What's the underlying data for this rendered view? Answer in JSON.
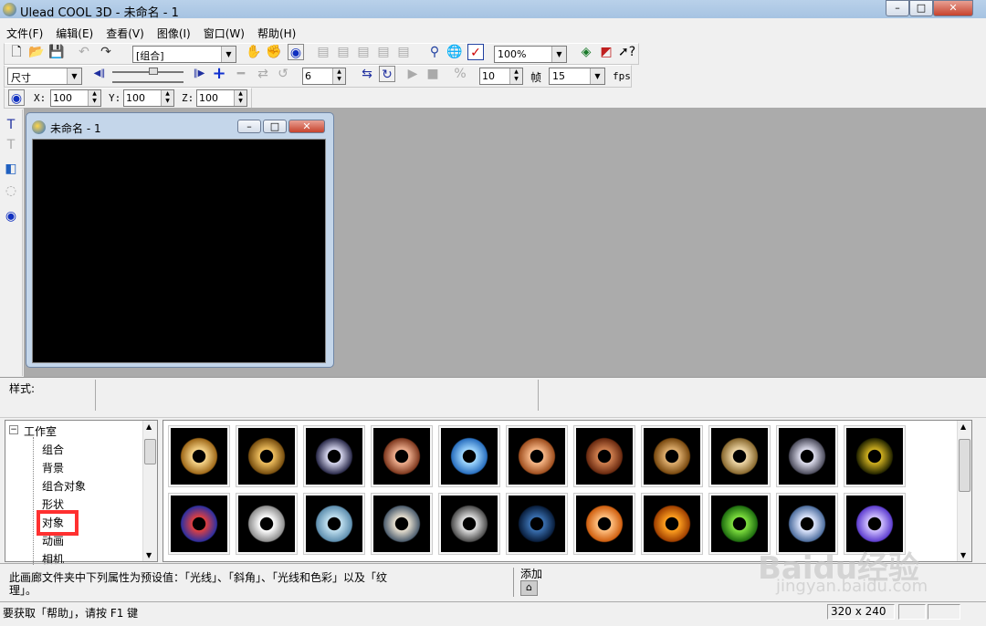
{
  "window": {
    "title": "Ulead COOL 3D - 未命名 - 1",
    "min": "–",
    "max": "□",
    "close": "✕"
  },
  "menu": [
    "文件(F)",
    "编辑(E)",
    "查看(V)",
    "图像(I)",
    "窗口(W)",
    "帮助(H)"
  ],
  "toolbar1": {
    "object_combo": "[组合]",
    "zoom_combo": "100%"
  },
  "toolbar2": {
    "attr_combo": "尺寸",
    "spin1": "6",
    "spin2": "10",
    "frame_label": "帧",
    "fps_combo": "15",
    "fps_label": "fps"
  },
  "toolbar3": {
    "x_label": "X:",
    "x": "100",
    "y_label": "Y:",
    "y": "100",
    "z_label": "Z:",
    "z": "100"
  },
  "child": {
    "title": "未命名 - 1"
  },
  "style_panel": {
    "label": "样式:"
  },
  "tree": {
    "root": "工作室",
    "items": [
      "组合",
      "背景",
      "组合对象",
      "形状",
      "对象",
      "动画",
      "相机"
    ],
    "selected": "对象"
  },
  "gallery": {
    "colors": [
      [
        "#f7d58a",
        "#a06a1a"
      ],
      [
        "#f0c060",
        "#7a5010"
      ],
      [
        "#d8d8f0",
        "#303050"
      ],
      [
        "#f0b090",
        "#803a20"
      ],
      [
        "#a0d8ff",
        "#2a70c0"
      ],
      [
        "#f8b888",
        "#a05020"
      ],
      [
        "#d08050",
        "#6a2a10"
      ],
      [
        "#e0b070",
        "#7a4a10"
      ],
      [
        "#f0d8a8",
        "#8a6a30"
      ],
      [
        "#e0e0f0",
        "#505060"
      ],
      [
        "#d0b020",
        "#2a2a00"
      ],
      [
        "#e04040",
        "#3030a0"
      ],
      [
        "#ffffff",
        "#909090"
      ],
      [
        "#c0e0f0",
        "#6090b0"
      ],
      [
        "#e8e0d0",
        "#506070"
      ],
      [
        "#e0e0e0",
        "#505050"
      ],
      [
        "#3a70b0",
        "#0a2040"
      ],
      [
        "#ffc080",
        "#d06010"
      ],
      [
        "#ffa020",
        "#a04000"
      ],
      [
        "#80e040",
        "#207010"
      ],
      [
        "#e0e8ff",
        "#5070a0"
      ],
      [
        "#d0c0ff",
        "#6040d0"
      ]
    ]
  },
  "description": {
    "line1": "此画廊文件夹中下列属性为预设值：「光线」、「斜角」、「光线和色彩」以及「纹",
    "line2": "理」。",
    "add_label": "添加"
  },
  "status": {
    "help": "要获取「帮助」，请按 F1 键",
    "size": "320 x 240"
  },
  "watermark": {
    "brand": "Baidu经验",
    "url": "jingyan.baidu.com"
  },
  "accent": {
    "highlight": "#ff3030"
  }
}
